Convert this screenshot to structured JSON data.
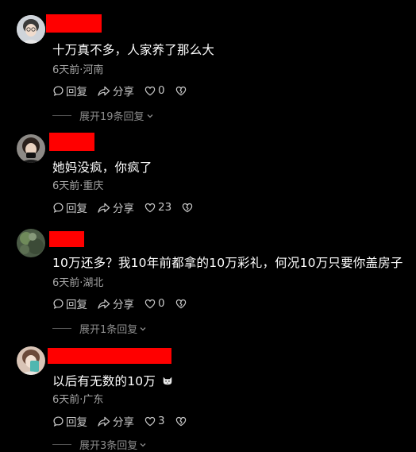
{
  "comments": [
    {
      "text": "十万真不多，人家养了那么大",
      "meta": "6天前·河南",
      "reply_label": "回复",
      "share_label": "分享",
      "likes": "0",
      "expand": "展开19条回复"
    },
    {
      "text": "她妈没疯，你疯了",
      "meta": "6天前·重庆",
      "reply_label": "回复",
      "share_label": "分享",
      "likes": "23"
    },
    {
      "text": "10万还多？我10年前都拿的10万彩礼，何况10万只要你盖房子",
      "meta": "6天前·湖北",
      "reply_label": "回复",
      "share_label": "分享",
      "likes": "0",
      "expand": "展开1条回复"
    },
    {
      "text": "以后有无数的10万",
      "meta": "6天前·广东",
      "reply_label": "回复",
      "share_label": "分享",
      "likes": "3",
      "expand": "展开3条回复"
    }
  ],
  "colors": {
    "background": "#000000",
    "redaction": "#ff0000",
    "meta_text": "#a6a6a6",
    "action_text": "#c8c8c8"
  },
  "icons": {
    "reply": "comment-bubble-icon",
    "share": "share-arrow-icon",
    "like": "heart-icon",
    "dislike": "broken-heart-icon",
    "expand": "chevron-down-icon",
    "emoji": "cat-face-emoji-icon"
  }
}
